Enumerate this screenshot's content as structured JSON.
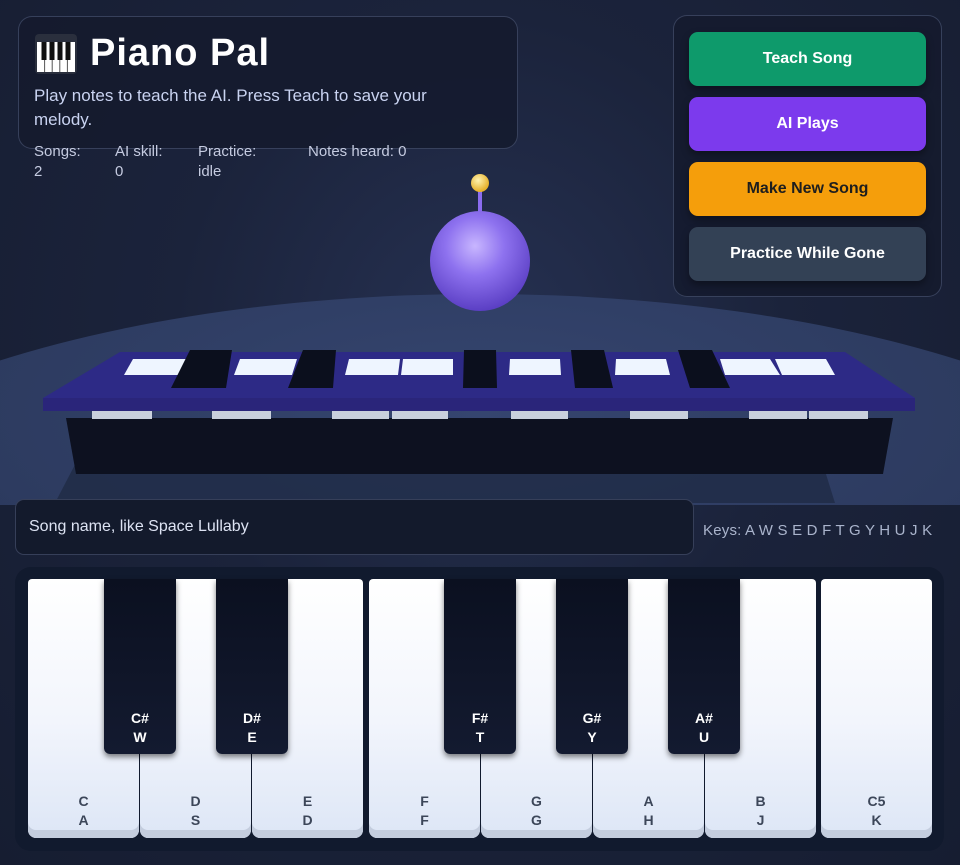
{
  "app": {
    "title": "Piano Pal",
    "subtitle": "Play notes to teach the AI. Press Teach to save your melody."
  },
  "stats": {
    "songs": {
      "label": "Songs:",
      "value": "2"
    },
    "ai_skill": {
      "label": "AI skill:",
      "value": "0"
    },
    "practice": {
      "label": "Practice:",
      "value": "idle"
    },
    "notes_heard": {
      "label": "Notes heard:",
      "value": "0"
    }
  },
  "buttons": {
    "teach": "Teach Song",
    "ai_plays": "AI Plays",
    "make_new": "Make New Song",
    "practice": "Practice While Gone"
  },
  "song_input": {
    "placeholder": "Song name, like Space Lullaby",
    "value": ""
  },
  "keys_hint": "Keys: A W S E D F T G Y H U J K",
  "piano": {
    "white_keys": [
      {
        "note": "C",
        "key": "A"
      },
      {
        "note": "D",
        "key": "S"
      },
      {
        "note": "E",
        "key": "D"
      },
      {
        "note": "F",
        "key": "F"
      },
      {
        "note": "G",
        "key": "G"
      },
      {
        "note": "A",
        "key": "H"
      },
      {
        "note": "B",
        "key": "J"
      },
      {
        "note": "C5",
        "key": "K"
      }
    ],
    "black_keys": [
      {
        "note": "C#",
        "key": "W"
      },
      {
        "note": "D#",
        "key": "E"
      },
      {
        "note": "F#",
        "key": "T"
      },
      {
        "note": "G#",
        "key": "Y"
      },
      {
        "note": "A#",
        "key": "U"
      }
    ]
  },
  "colors": {
    "teach": "#0e9a6b",
    "ai_plays": "#7c3aed",
    "make_new": "#f59e0b",
    "practice": "#334155",
    "robot": "#8b6cf0",
    "antenna_tip": "#f5c542"
  }
}
